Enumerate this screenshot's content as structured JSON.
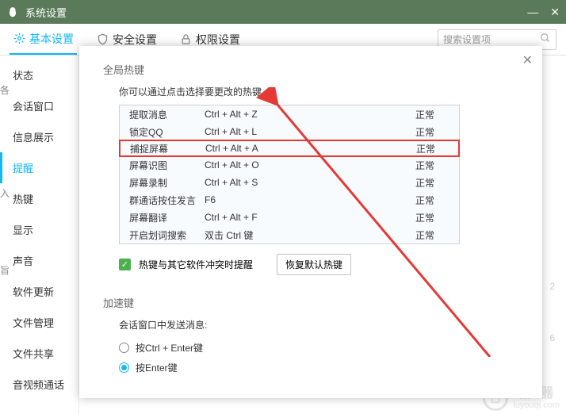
{
  "window": {
    "title": "系统设置"
  },
  "tabs": {
    "basic": "基本设置",
    "security": "安全设置",
    "permission": "权限设置"
  },
  "search": {
    "placeholder": "搜索设置项"
  },
  "sidebar": {
    "items": [
      "状态",
      "会话窗口",
      "信息展示",
      "提醒",
      "热键",
      "显示",
      "声音",
      "软件更新",
      "文件管理",
      "文件共享",
      "音视频通话"
    ]
  },
  "dialog": {
    "global_title": "全局热键",
    "global_desc": "你可以通过点击选择要更改的热键。",
    "hotkeys": [
      {
        "name": "提取消息",
        "key": "Ctrl + Alt + Z",
        "status": "正常",
        "hl": false
      },
      {
        "name": "锁定QQ",
        "key": "Ctrl + Alt + L",
        "status": "正常",
        "hl": false
      },
      {
        "name": "捕捉屏幕",
        "key": "Ctrl + Alt + A",
        "status": "正常",
        "hl": true
      },
      {
        "name": "屏幕识图",
        "key": "Ctrl + Alt + O",
        "status": "正常",
        "hl": false
      },
      {
        "name": "屏幕录制",
        "key": "Ctrl + Alt + S",
        "status": "正常",
        "hl": false
      },
      {
        "name": "群通话按住发言",
        "key": "F6",
        "status": "正常",
        "hl": false
      },
      {
        "name": "屏幕翻译",
        "key": "Ctrl + Alt + F",
        "status": "正常",
        "hl": false
      },
      {
        "name": "开启划词搜索",
        "key": "双击 Ctrl 键",
        "status": "正常",
        "hl": false
      }
    ],
    "conflict_label": "热键与其它软件冲突时提醒",
    "restore_btn": "恢复默认热键",
    "accel_title": "加速键",
    "accel_desc": "会话窗口中发送消息:",
    "radios": [
      {
        "label": "按Ctrl + Enter键",
        "checked": false
      },
      {
        "label": "按Enter键",
        "checked": true
      }
    ]
  },
  "path": "C:\\Users\\Administrator\\Desktop",
  "watermark": {
    "name": "路由器",
    "url": "luyouqi.com"
  },
  "side_nums": {
    "a": "2",
    "b": "6"
  }
}
